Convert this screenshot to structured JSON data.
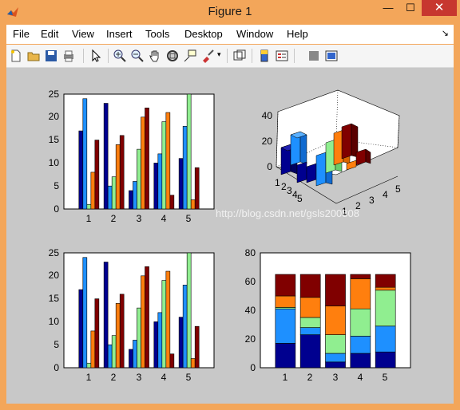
{
  "window": {
    "title": "Figure 1",
    "minimize": "—",
    "maximize": "☐",
    "close": "✕"
  },
  "menu": [
    "File",
    "Edit",
    "View",
    "Insert",
    "Tools",
    "Desktop",
    "Window",
    "Help"
  ],
  "toolbar": [
    "new-figure",
    "open-file",
    "save",
    "print",
    "pointer",
    "zoom-in",
    "zoom-out",
    "pan",
    "rotate-3d",
    "data-cursor",
    "brush",
    "link-plot",
    "colorbar",
    "legend",
    "hide-plot-tools",
    "show-plot-tools"
  ],
  "watermark": "http://blog.csdn.net/gsls200808",
  "colors": {
    "series": [
      "#00008f",
      "#1e90ff",
      "#90ee90",
      "#ff7f0e",
      "#800000"
    ],
    "close": "#c7372f",
    "figure_bg": "#c8c8c8"
  },
  "chart_data": [
    {
      "type": "bar",
      "style": "grouped",
      "categories": [
        "1",
        "2",
        "3",
        "4",
        "5"
      ],
      "series": [
        {
          "values": [
            17,
            23,
            4,
            10,
            11
          ]
        },
        {
          "values": [
            24,
            5,
            6,
            12,
            18
          ]
        },
        {
          "values": [
            1,
            7,
            13,
            19,
            25
          ]
        },
        {
          "values": [
            8,
            14,
            20,
            21,
            2
          ]
        },
        {
          "values": [
            15,
            16,
            22,
            3,
            9
          ]
        }
      ],
      "ylim": [
        0,
        25
      ],
      "yticks": [
        "0",
        "5",
        "10",
        "15",
        "20",
        "25"
      ]
    },
    {
      "type": "bar",
      "style": "3d",
      "categories": [
        "1",
        "2",
        "3",
        "4",
        "5"
      ],
      "zticks": [
        "0",
        "20",
        "40"
      ],
      "xticks": [
        "1",
        "2",
        "3",
        "4",
        "5"
      ]
    },
    {
      "type": "bar",
      "style": "grouped",
      "categories": [
        "1",
        "2",
        "3",
        "4",
        "5"
      ],
      "series": [
        {
          "values": [
            17,
            23,
            4,
            10,
            11
          ]
        },
        {
          "values": [
            24,
            5,
            6,
            12,
            18
          ]
        },
        {
          "values": [
            1,
            7,
            13,
            19,
            25
          ]
        },
        {
          "values": [
            8,
            14,
            20,
            21,
            2
          ]
        },
        {
          "values": [
            15,
            16,
            22,
            3,
            9
          ]
        }
      ],
      "ylim": [
        0,
        25
      ],
      "yticks": [
        "0",
        "5",
        "10",
        "15",
        "20",
        "25"
      ]
    },
    {
      "type": "bar",
      "style": "stacked",
      "categories": [
        "1",
        "2",
        "3",
        "4",
        "5"
      ],
      "series": [
        {
          "values": [
            17,
            23,
            4,
            10,
            11
          ]
        },
        {
          "values": [
            24,
            5,
            6,
            12,
            18
          ]
        },
        {
          "values": [
            1,
            7,
            13,
            19,
            25
          ]
        },
        {
          "values": [
            8,
            14,
            20,
            21,
            2
          ]
        },
        {
          "values": [
            15,
            16,
            22,
            3,
            9
          ]
        }
      ],
      "ylim": [
        0,
        80
      ],
      "yticks": [
        "0",
        "20",
        "40",
        "60",
        "80"
      ]
    }
  ]
}
